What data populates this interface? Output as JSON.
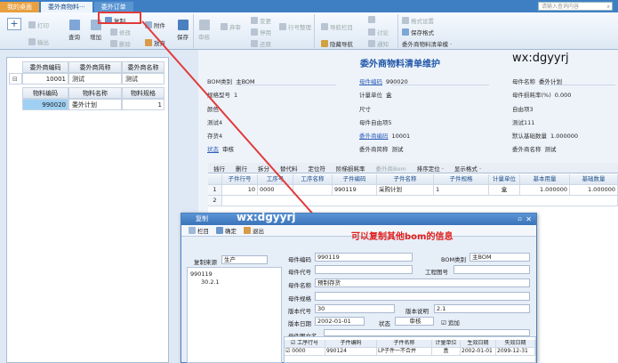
{
  "tabs": [
    {
      "label": "我的桌面"
    },
    {
      "label": "委外商物料···"
    },
    {
      "label": "委外订单"
    }
  ],
  "search": {
    "placeholder": "请输入查询内容"
  },
  "ribbon": {
    "print": "打印",
    "export": "输出",
    "query": "查询",
    "add": "增加",
    "copy": "复制",
    "modify": "修改",
    "delete": "删除",
    "attachment": "附件",
    "abandon": "放弃",
    "save": "保存",
    "approve": "审核",
    "withdraw": "弃审",
    "change": "变更",
    "stop": "停用",
    "restore": "还原",
    "row_org": "行号整理",
    "hide_nav": "隐藏导航",
    "discuss": "讨论",
    "notify": "通知",
    "nav": "导航栏目",
    "format": "格式设置",
    "save_format": "保存格式",
    "template": "委外商物料清单模 ·"
  },
  "left_table": {
    "headers1": [
      "委外商编码",
      "委外商简称",
      "委外商名称"
    ],
    "row1": [
      "10001",
      "测试",
      "测试"
    ],
    "headers2": [
      "物料编码",
      "物料名称",
      "物料规格"
    ],
    "row2": [
      "990020",
      "委外计划",
      "1"
    ]
  },
  "form": {
    "title": "委外商物料清单维护",
    "watermark1": "wx:dgyyrj",
    "fields": [
      {
        "label": "BOM类别",
        "value": "主BOM"
      },
      {
        "label": "母件编码",
        "value": "990020"
      },
      {
        "label": "母件名称",
        "value": "委外计划"
      },
      {
        "label": "规格型号",
        "value": "1"
      },
      {
        "label": "计量单位",
        "value": "盒"
      },
      {
        "label": "母件损耗率(%)",
        "value": "0.000"
      },
      {
        "label": "颜色",
        "value": ""
      },
      {
        "label": "尺寸",
        "value": ""
      },
      {
        "label": "自由项3",
        "value": ""
      },
      {
        "label": "测试4",
        "value": ""
      },
      {
        "label": "母件自由项5",
        "value": ""
      },
      {
        "label": "测试111",
        "value": ""
      },
      {
        "label": "存货4",
        "value": ""
      },
      {
        "label": "委外商编码",
        "value": "10001"
      },
      {
        "label": "默认基础数量",
        "value": "1.000000"
      },
      {
        "label": "状态",
        "value": "审核"
      },
      {
        "label": "委外商简称",
        "value": "测试"
      },
      {
        "label": "委外商名称",
        "value": "测试"
      }
    ]
  },
  "grid_tabs": [
    "插行",
    "删行",
    "拆分",
    "替代料",
    "定位符",
    "阶梯损耗率",
    "委外商Bom",
    "排序定位 ·",
    "显示格式 ·"
  ],
  "grid": {
    "headers": [
      "子件行号",
      "工序号",
      "工序名称",
      "子件编码",
      "子件名称",
      "子件规格",
      "计量单位",
      "基本用量",
      "基础数量"
    ],
    "rows": [
      [
        "1",
        "10",
        "0000",
        "",
        "990119",
        "采购计划",
        "1",
        "盒",
        "1.000000",
        "1.000000"
      ],
      [
        "2",
        "",
        "",
        "",
        "",
        "",
        "",
        "",
        "",
        ""
      ]
    ]
  },
  "dialog": {
    "title": "复制",
    "watermark": "wx:dgyyrj",
    "tool_items": [
      "栏目",
      "确定",
      "退出"
    ],
    "source_label": "复制来源",
    "source_value": "生产",
    "tree": [
      "990119",
      "30.2.1"
    ],
    "labels": {
      "parent_code": "母件编码",
      "bom_type": "BOM类别",
      "parent_no": "母件代号",
      "drawing_no": "工程图号",
      "parent_name": "母件名称",
      "parent_spec": "母件规格",
      "version_code": "版本代号",
      "version_desc": "版本说明",
      "version_date": "版本日期",
      "status": "状态",
      "add": "追加",
      "parent_doc": "母件图文名"
    },
    "values": {
      "parent_code": "990119",
      "bom_type": "主BOM",
      "parent_name": "预制存货",
      "version_code": "30",
      "version_desc": "2.1",
      "version_date": "2002-01-01",
      "status": "审核"
    },
    "grid_headers": [
      "工序行号",
      "子件编码",
      "子件名称",
      "计量单位",
      "生效日期",
      "失效日期"
    ],
    "grid_row": [
      "0000",
      "990124",
      "LP子件一不合并",
      "盒",
      "2002-01-01",
      "2099-12-31"
    ]
  },
  "annotation": "可以复制其他bom的信息",
  "colors": {
    "accent": "#3e7fc4",
    "highlight": "#e23a3a",
    "link": "#2f5fb8"
  }
}
